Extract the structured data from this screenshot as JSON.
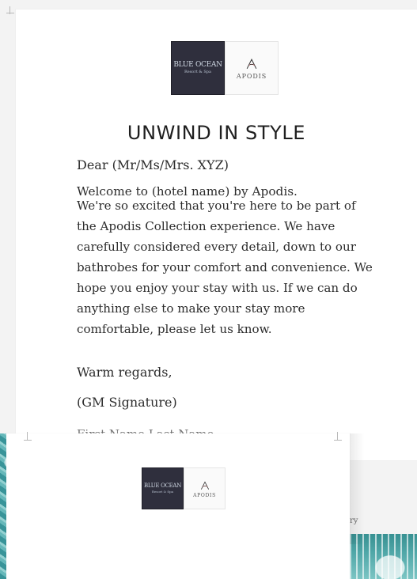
{
  "main_letter": {
    "logo": {
      "blue_ocean_label": "BLUE OCEAN",
      "resort_label": "Resort & Spa",
      "apodis_label": "APODIS"
    },
    "headline": "UNWIND IN STYLE",
    "salutation": "Dear (Mr/Ms/Mrs. XYZ)",
    "intro": "Welcome to (hotel name) by Apodis.",
    "body": "We're so excited that you're here to be part of the Apodis Collection experience. We have carefully considered every detail, down to our bathrobes for your comfort and convenience. We hope you enjoy your stay with us. If we can do anything else to make your stay more comfortable, please let us know.",
    "closing": "Warm regards,",
    "signature": "(GM Signature)",
    "name_partial": "First Name Last Name"
  },
  "second_card": {
    "logo": {
      "blue_ocean_label": "BLUE OCEAN",
      "resort_label": "Resort & Spa",
      "apodis_label": "APODIS"
    }
  },
  "partial_text": "ry"
}
